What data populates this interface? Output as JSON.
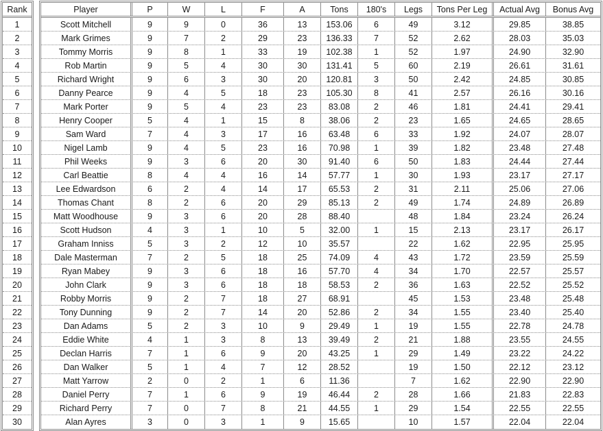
{
  "rank_header": "Rank",
  "columns": [
    "Player",
    "P",
    "W",
    "L",
    "F",
    "A",
    "Tons",
    "180's",
    "Legs",
    "Tons Per Leg",
    "Actual Avg",
    "Bonus Avg"
  ],
  "rows": [
    [
      "1",
      "Scott Mitchell",
      "9",
      "9",
      "0",
      "36",
      "13",
      "153.06",
      "6",
      "49",
      "3.12",
      "29.85",
      "38.85"
    ],
    [
      "2",
      "Mark Grimes",
      "9",
      "7",
      "2",
      "29",
      "23",
      "136.33",
      "7",
      "52",
      "2.62",
      "28.03",
      "35.03"
    ],
    [
      "3",
      "Tommy Morris",
      "9",
      "8",
      "1",
      "33",
      "19",
      "102.38",
      "1",
      "52",
      "1.97",
      "24.90",
      "32.90"
    ],
    [
      "4",
      "Rob Martin",
      "9",
      "5",
      "4",
      "30",
      "30",
      "131.41",
      "5",
      "60",
      "2.19",
      "26.61",
      "31.61"
    ],
    [
      "5",
      "Richard Wright",
      "9",
      "6",
      "3",
      "30",
      "20",
      "120.81",
      "3",
      "50",
      "2.42",
      "24.85",
      "30.85"
    ],
    [
      "6",
      "Danny Pearce",
      "9",
      "4",
      "5",
      "18",
      "23",
      "105.30",
      "8",
      "41",
      "2.57",
      "26.16",
      "30.16"
    ],
    [
      "7",
      "Mark Porter",
      "9",
      "5",
      "4",
      "23",
      "23",
      "83.08",
      "2",
      "46",
      "1.81",
      "24.41",
      "29.41"
    ],
    [
      "8",
      "Henry Cooper",
      "5",
      "4",
      "1",
      "15",
      "8",
      "38.06",
      "2",
      "23",
      "1.65",
      "24.65",
      "28.65"
    ],
    [
      "9",
      "Sam Ward",
      "7",
      "4",
      "3",
      "17",
      "16",
      "63.48",
      "6",
      "33",
      "1.92",
      "24.07",
      "28.07"
    ],
    [
      "10",
      "Nigel Lamb",
      "9",
      "4",
      "5",
      "23",
      "16",
      "70.98",
      "1",
      "39",
      "1.82",
      "23.48",
      "27.48"
    ],
    [
      "11",
      "Phil Weeks",
      "9",
      "3",
      "6",
      "20",
      "30",
      "91.40",
      "6",
      "50",
      "1.83",
      "24.44",
      "27.44"
    ],
    [
      "12",
      "Carl Beattie",
      "8",
      "4",
      "4",
      "16",
      "14",
      "57.77",
      "1",
      "30",
      "1.93",
      "23.17",
      "27.17"
    ],
    [
      "13",
      "Lee Edwardson",
      "6",
      "2",
      "4",
      "14",
      "17",
      "65.53",
      "2",
      "31",
      "2.11",
      "25.06",
      "27.06"
    ],
    [
      "14",
      "Thomas Chant",
      "8",
      "2",
      "6",
      "20",
      "29",
      "85.13",
      "2",
      "49",
      "1.74",
      "24.89",
      "26.89"
    ],
    [
      "15",
      "Matt Woodhouse",
      "9",
      "3",
      "6",
      "20",
      "28",
      "88.40",
      "",
      "48",
      "1.84",
      "23.24",
      "26.24"
    ],
    [
      "16",
      "Scott Hudson",
      "4",
      "3",
      "1",
      "10",
      "5",
      "32.00",
      "1",
      "15",
      "2.13",
      "23.17",
      "26.17"
    ],
    [
      "17",
      "Graham Inniss",
      "5",
      "3",
      "2",
      "12",
      "10",
      "35.57",
      "",
      "22",
      "1.62",
      "22.95",
      "25.95"
    ],
    [
      "18",
      "Dale Masterman",
      "7",
      "2",
      "5",
      "18",
      "25",
      "74.09",
      "4",
      "43",
      "1.72",
      "23.59",
      "25.59"
    ],
    [
      "19",
      "Ryan Mabey",
      "9",
      "3",
      "6",
      "18",
      "16",
      "57.70",
      "4",
      "34",
      "1.70",
      "22.57",
      "25.57"
    ],
    [
      "20",
      "John Clark",
      "9",
      "3",
      "6",
      "18",
      "18",
      "58.53",
      "2",
      "36",
      "1.63",
      "22.52",
      "25.52"
    ],
    [
      "21",
      "Robby Morris",
      "9",
      "2",
      "7",
      "18",
      "27",
      "68.91",
      "",
      "45",
      "1.53",
      "23.48",
      "25.48"
    ],
    [
      "22",
      "Tony Dunning",
      "9",
      "2",
      "7",
      "14",
      "20",
      "52.86",
      "2",
      "34",
      "1.55",
      "23.40",
      "25.40"
    ],
    [
      "23",
      "Dan Adams",
      "5",
      "2",
      "3",
      "10",
      "9",
      "29.49",
      "1",
      "19",
      "1.55",
      "22.78",
      "24.78"
    ],
    [
      "24",
      "Eddie White",
      "4",
      "1",
      "3",
      "8",
      "13",
      "39.49",
      "2",
      "21",
      "1.88",
      "23.55",
      "24.55"
    ],
    [
      "25",
      "Declan Harris",
      "7",
      "1",
      "6",
      "9",
      "20",
      "43.25",
      "1",
      "29",
      "1.49",
      "23.22",
      "24.22"
    ],
    [
      "26",
      "Dan Walker",
      "5",
      "1",
      "4",
      "7",
      "12",
      "28.52",
      "",
      "19",
      "1.50",
      "22.12",
      "23.12"
    ],
    [
      "27",
      "Matt Yarrow",
      "2",
      "0",
      "2",
      "1",
      "6",
      "11.36",
      "",
      "7",
      "1.62",
      "22.90",
      "22.90"
    ],
    [
      "28",
      "Daniel Perry",
      "7",
      "1",
      "6",
      "9",
      "19",
      "46.44",
      "2",
      "28",
      "1.66",
      "21.83",
      "22.83"
    ],
    [
      "29",
      "Richard Perry",
      "7",
      "0",
      "7",
      "8",
      "21",
      "44.55",
      "1",
      "29",
      "1.54",
      "22.55",
      "22.55"
    ],
    [
      "30",
      "Alan Ayres",
      "3",
      "0",
      "3",
      "1",
      "9",
      "15.65",
      "",
      "10",
      "1.57",
      "22.04",
      "22.04"
    ]
  ]
}
